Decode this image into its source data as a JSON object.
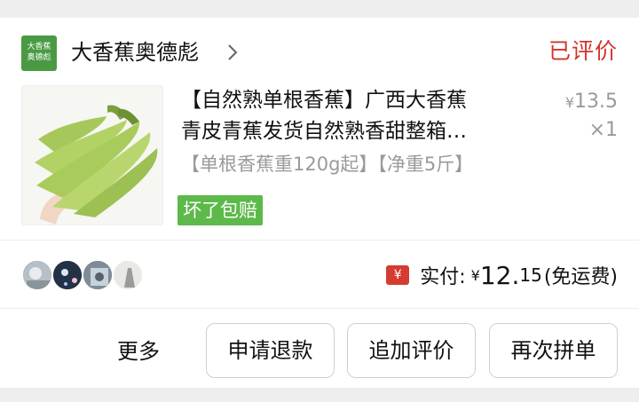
{
  "store": {
    "logo_text_line1": "大香蕉",
    "logo_text_line2": "奥德彪",
    "name": "大香蕉奥德彪",
    "chevron_icon": "chevron-right-icon"
  },
  "order": {
    "status": "已评价",
    "status_color": "#d3342c"
  },
  "product": {
    "title_line1": "【自然熟单根香蕉】广西大香蕉",
    "title_line2": "青皮青蕉发货自然熟香甜整箱…",
    "spec": "【单根香蕉重120g起】【净重5斤】",
    "price_symbol": "¥",
    "price": "13.5",
    "quantity": "×1",
    "badge": "坏了包赔",
    "badge_color": "#5cb94a"
  },
  "payment": {
    "icon": "yuan-tag-icon",
    "icon_glyph": "¥",
    "label": "实付:",
    "symbol": "¥",
    "amount_int": "12.",
    "amount_dec": "15",
    "note": "(免运费)"
  },
  "actions": {
    "more": "更多",
    "refund": "申请退款",
    "add_review": "追加评价",
    "reorder": "再次拼单"
  }
}
